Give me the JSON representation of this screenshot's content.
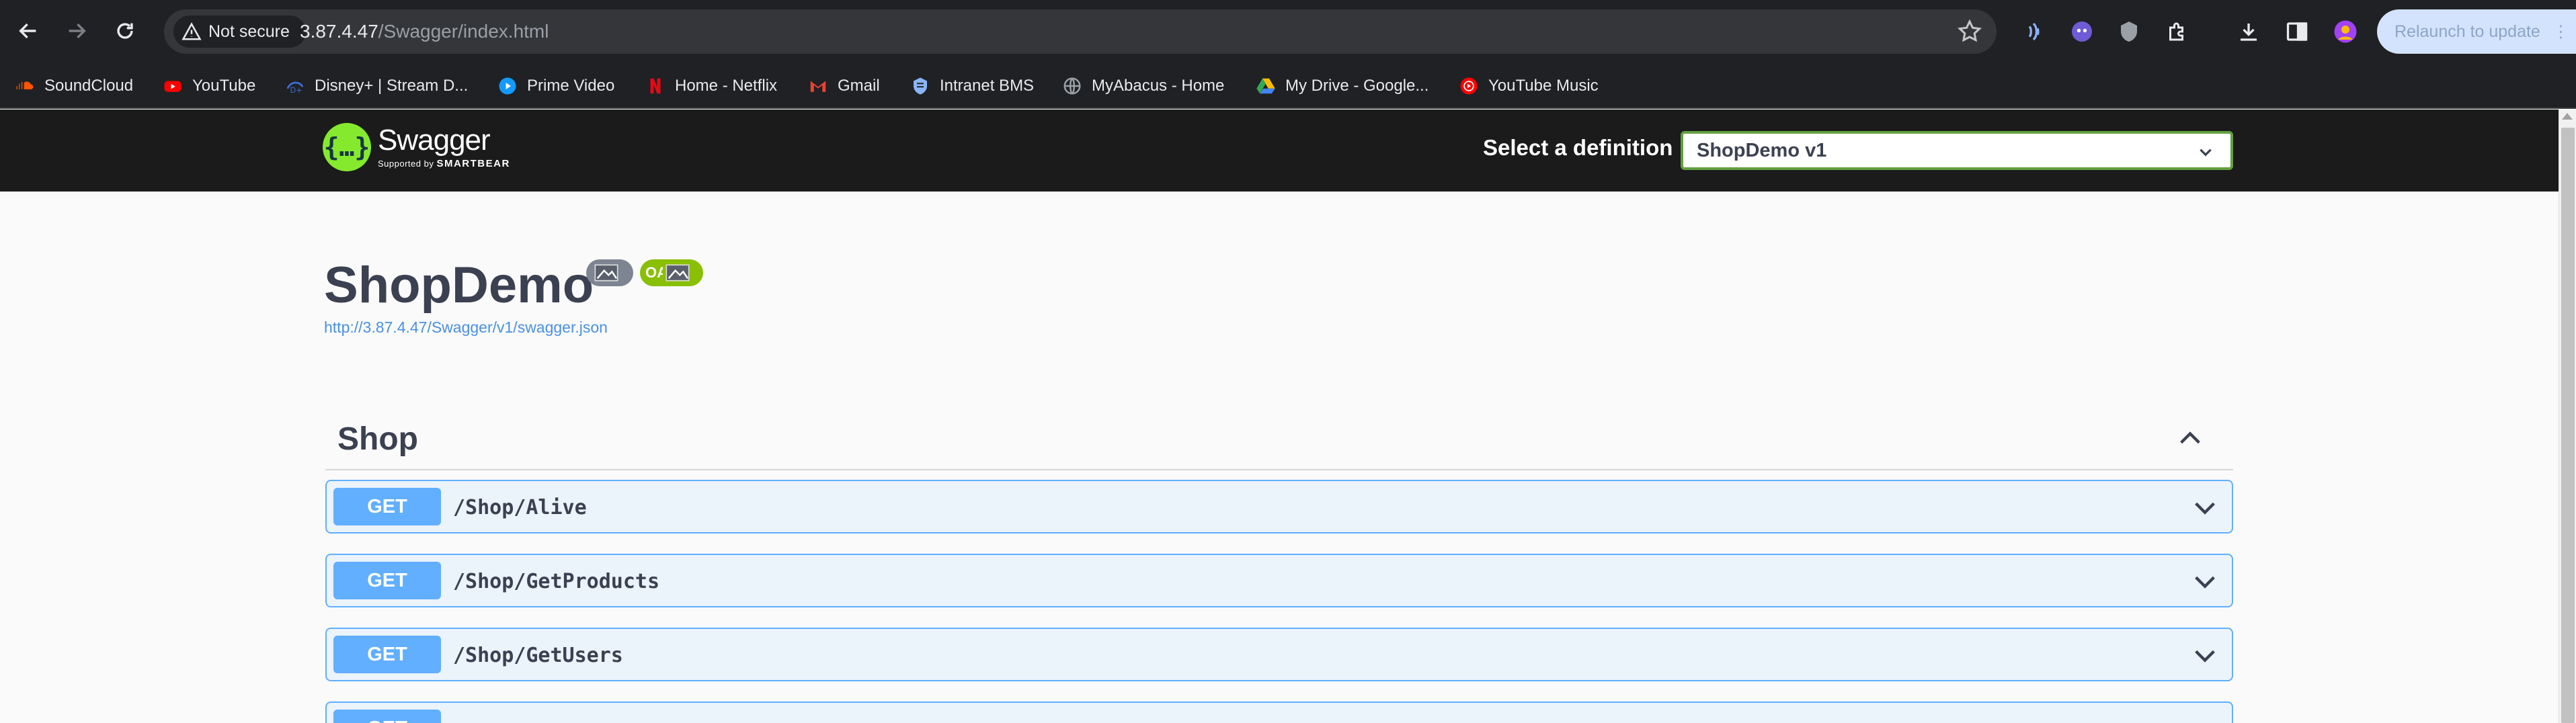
{
  "browser": {
    "security_label": "Not secure",
    "url_host": "3.87.4.47",
    "url_path": "/Swagger/index.html",
    "relaunch_label": "Relaunch to update",
    "bookmarks": [
      {
        "label": "SoundCloud",
        "icon": "soundcloud-icon",
        "color": "#ff5500"
      },
      {
        "label": "YouTube",
        "icon": "youtube-icon",
        "color": "#ff0000"
      },
      {
        "label": "Disney+ | Stream D...",
        "icon": "disney-plus-icon",
        "color": "#1a3fa0"
      },
      {
        "label": "Prime Video",
        "icon": "prime-video-icon",
        "color": "#1399ff"
      },
      {
        "label": "Home - Netflix",
        "icon": "netflix-icon",
        "color": "#e50914"
      },
      {
        "label": "Gmail",
        "icon": "gmail-icon",
        "color": "#ea4335"
      },
      {
        "label": "Intranet BMS",
        "icon": "shield-icon",
        "color": "#8ab4f8"
      },
      {
        "label": "MyAbacus - Home",
        "icon": "globe-icon",
        "color": "#9aa0a6"
      },
      {
        "label": "My Drive - Google...",
        "icon": "google-drive-icon",
        "color": "#fbbc04"
      },
      {
        "label": "YouTube Music",
        "icon": "youtube-music-icon",
        "color": "#ff0000"
      }
    ]
  },
  "swagger": {
    "logo_title": "Swagger",
    "logo_supported_by": "Supported by",
    "logo_company": "SMARTBEAR",
    "definition_label": "Select a definition",
    "definition_selected": "ShopDemo v1",
    "api_title": "ShopDemo",
    "spec_url": "http://3.87.4.47/Swagger/v1/swagger.json",
    "badge_oas": "OAS",
    "tag": "Shop",
    "operations": [
      {
        "method": "GET",
        "path": "/Shop/Alive"
      },
      {
        "method": "GET",
        "path": "/Shop/GetProducts"
      },
      {
        "method": "GET",
        "path": "/Shop/GetUsers"
      },
      {
        "method": "GET",
        "path": ""
      }
    ],
    "colors": {
      "get_accent": "#61affe",
      "get_background": "#ebf3fb",
      "topbar": "#1b1b1b",
      "logo_green": "#85ea2d",
      "select_border": "#62a03f",
      "link": "#4990e2"
    }
  }
}
